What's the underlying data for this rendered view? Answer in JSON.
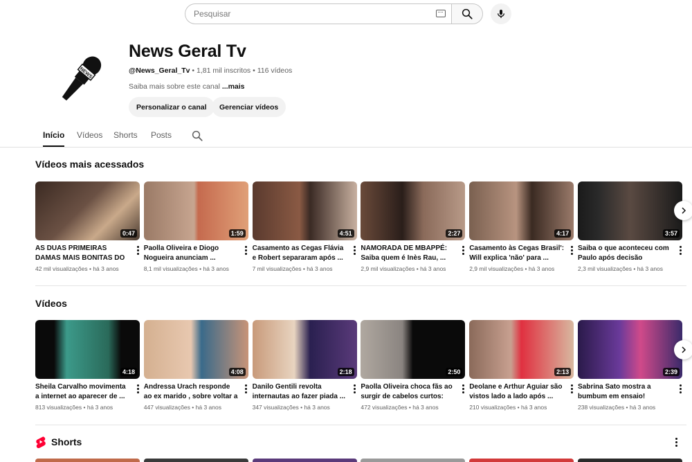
{
  "search": {
    "placeholder": "Pesquisar"
  },
  "channel": {
    "name": "News Geral Tv",
    "handle": "@News_Geral_Tv",
    "subscribers": "1,81 mil inscritos",
    "videos_count": "116 vídeos",
    "separator": "•",
    "about_text": "Saiba mais sobre este canal",
    "about_more": "...mais",
    "customize_label": "Personalizar o canal",
    "manage_label": "Gerenciar vídeos",
    "avatar_text": "NEWS"
  },
  "tabs": [
    {
      "label": "Início",
      "active": true
    },
    {
      "label": "Vídeos",
      "active": false
    },
    {
      "label": "Shorts",
      "active": false
    },
    {
      "label": "Posts",
      "active": false
    }
  ],
  "popular": {
    "title": "Vídeos mais acessados",
    "videos": [
      {
        "title": "AS DUAS PRIMEIRAS DAMAS MAIS BONITAS DO BRASIL",
        "views": "42 mil visualizações",
        "age": "há 3 anos",
        "duration": "0:47"
      },
      {
        "title": "Paolla Oliveira e Diogo Nogueira  anunciam ...",
        "views": "8,1 mil visualizações",
        "age": "há 3 anos",
        "duration": "1:59"
      },
      {
        "title": "Casamento as Cegas Flávia e Robert separaram após ...",
        "views": "7 mil visualizações",
        "age": "há 3 anos",
        "duration": "4:51"
      },
      {
        "title": "NAMORADA DE MBAPPÉ: Saiba quem é Inès Rau, ...",
        "views": "2,9 mil visualizações",
        "age": "há 3 anos",
        "duration": "2:27"
      },
      {
        "title": "Casamento às Cegas Brasil': Will explica 'não' para ...",
        "views": "2,9 mil visualizações",
        "age": "há 3 anos",
        "duration": "4:17"
      },
      {
        "title": "Saiba o que aconteceu com Paulo após decisão polêmic...",
        "views": "2,3 mil visualizações",
        "age": "há 3 anos",
        "duration": "3:57"
      }
    ]
  },
  "videos": {
    "title": "Vídeos",
    "videos": [
      {
        "title": "Sheila Carvalho movimenta a internet ao aparecer de ...",
        "views": "813 visualizações",
        "age": "há 3 anos",
        "duration": "4:18"
      },
      {
        "title": "Andressa Urach responde ao ex marido , sobre voltar a ...",
        "views": "447 visualizações",
        "age": "há 3 anos",
        "duration": "4:08"
      },
      {
        "title": "Danilo Gentili revolta internautas ao fazer piada ...",
        "views": "347 visualizações",
        "age": "há 3 anos",
        "duration": "2:18"
      },
      {
        "title": "Paolla Oliveira choca fãs ao surgir de cabelos curtos: 'El...",
        "views": "472 visualizações",
        "age": "há 3 anos",
        "duration": "2:50"
      },
      {
        "title": "Deolane e Arthur Aguiar são vistos lado a lado após ...",
        "views": "210 visualizações",
        "age": "há 3 anos",
        "duration": "2:13"
      },
      {
        "title": "Sabrina Sato mostra a bumbum em ensaio!",
        "views": "238 visualizações",
        "age": "há 3 anos",
        "duration": "2:39"
      }
    ]
  },
  "shorts": {
    "title": "Shorts"
  },
  "colors": {
    "shorts_red": "#ff0033",
    "text": "#0f0f0f",
    "muted": "#606060"
  }
}
